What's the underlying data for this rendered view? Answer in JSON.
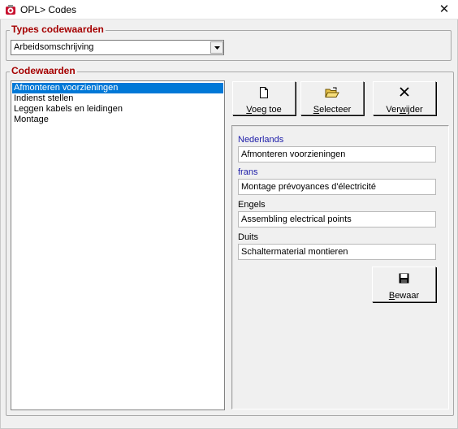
{
  "window": {
    "title": "OPL> Codes",
    "close_glyph": "✕",
    "icon": "app-icon"
  },
  "types": {
    "group_title": "Types codewaarden",
    "selected": "Arbeidsomschrijving"
  },
  "codes": {
    "group_title": "Codewaarden",
    "items": [
      "Afmonteren voorzieningen",
      "Indienst stellen",
      "Leggen kabels en leidingen",
      "Montage"
    ],
    "selected_index": 0
  },
  "toolbar": {
    "add": {
      "label_pre": "",
      "label_key": "V",
      "label_post": "oeg toe",
      "icon": "new-document-icon"
    },
    "select": {
      "label_pre": "",
      "label_key": "S",
      "label_post": "electeer",
      "icon": "open-folder-icon"
    },
    "delete": {
      "label_pre": "Ver",
      "label_key": "w",
      "label_post": "ijder",
      "icon": "delete-x-icon"
    }
  },
  "details": {
    "fields": [
      {
        "label": "Nederlands",
        "value": "Afmonteren voorzieningen"
      },
      {
        "label": "frans",
        "value": "Montage prévoyances d'électricité"
      },
      {
        "label": "Engels",
        "value": "Assembling electrical points"
      },
      {
        "label": "Duits",
        "value": "Schaltermaterial montieren"
      }
    ],
    "save": {
      "label_pre": "",
      "label_key": "B",
      "label_post": "ewaar",
      "icon": "floppy-disk-icon"
    }
  },
  "colors": {
    "group_title": "#a50000",
    "selection": "#0078d7",
    "field_label_blue": "#1c1ca8"
  }
}
